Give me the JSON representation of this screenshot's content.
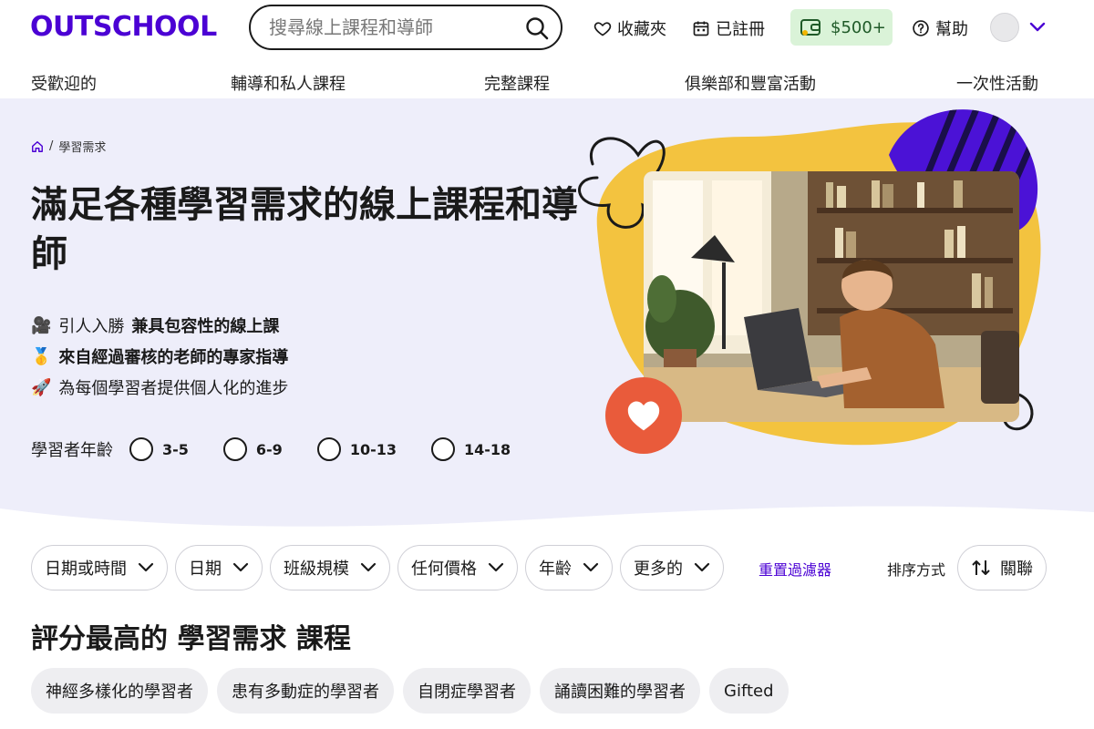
{
  "header": {
    "logo": "OUTSCHOOL",
    "search_placeholder": "搜尋線上課程和導師",
    "saved": "收藏夾",
    "enrolled": "已註冊",
    "credit": "$500+",
    "help": "幫助",
    "accent_color": "#4b01d4"
  },
  "category_nav": [
    "受歡迎的",
    "輔導和私人課程",
    "完整課程",
    "俱樂部和豐富活動",
    "一次性活動"
  ],
  "breadcrumb": {
    "current": "學習需求"
  },
  "hero": {
    "title": "滿足各種學習需求的線上課程和導師",
    "bullets": [
      {
        "icon": "🎥",
        "text": "引人入勝",
        "bold": "兼具包容性的線上課"
      },
      {
        "icon": "🥇",
        "text": "",
        "bold": "來自經過審核的老師的專家指導"
      },
      {
        "icon": "🚀",
        "text": "為每個學習者提供個人化的進步",
        "bold": ""
      }
    ],
    "age_label": "學習者年齡",
    "age_options": [
      "3-5",
      "6-9",
      "10-13",
      "14-18"
    ]
  },
  "filters": {
    "chips": [
      "日期或時間",
      "日期",
      "班級規模",
      "任何價格",
      "年齡",
      "更多的"
    ],
    "reset": "重置過濾器",
    "sort_label": "排序方式",
    "sort_value": "關聯"
  },
  "section": {
    "title": "評分最高的 學習需求 課程",
    "tags": [
      "神經多樣化的學習者",
      "患有多動症的學習者",
      "自閉症學習者",
      "誦讀困難的學習者",
      "Gifted"
    ]
  }
}
